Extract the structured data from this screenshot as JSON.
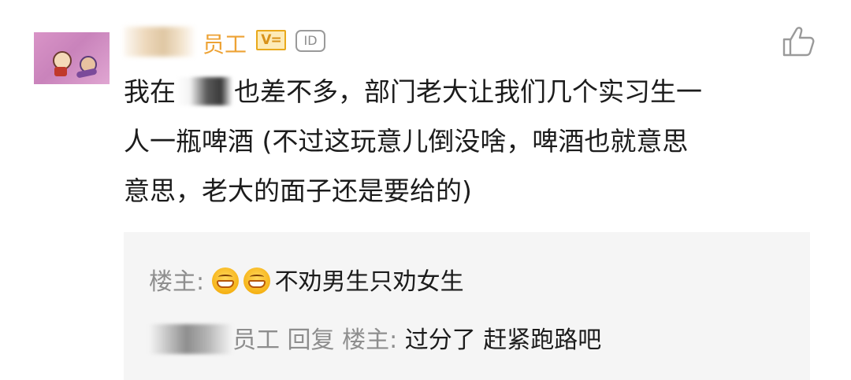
{
  "comment": {
    "author_suffix": "员工",
    "badges": {
      "vip": "V=",
      "id": "ID"
    },
    "text_lines": [
      {
        "before": "我在",
        "after": "也差不多，部门老大让我们几个实习生一"
      },
      {
        "text": "人一瓶啤酒 (不过这玩意儿倒没啥，啤酒也就意思"
      },
      {
        "text": "意思，老大的面子还是要给的)"
      }
    ]
  },
  "replies": [
    {
      "author": "楼主",
      "separator": ": ",
      "emoji_count": 2,
      "emoji_name": "grin-emoji",
      "text": "不劝男生只劝女生"
    },
    {
      "author_suffix": "员工",
      "action": " 回复 ",
      "target": "楼主",
      "separator": ":  ",
      "text": "过分了 赶紧跑路吧"
    }
  ],
  "icons": {
    "like": "thumbs-up-icon",
    "avatar": "avatar-image"
  },
  "colors": {
    "author": "#eda234",
    "vip_border": "#e9a91c",
    "secondary": "#8e8e8e",
    "reply_bg": "#f5f5f5"
  }
}
